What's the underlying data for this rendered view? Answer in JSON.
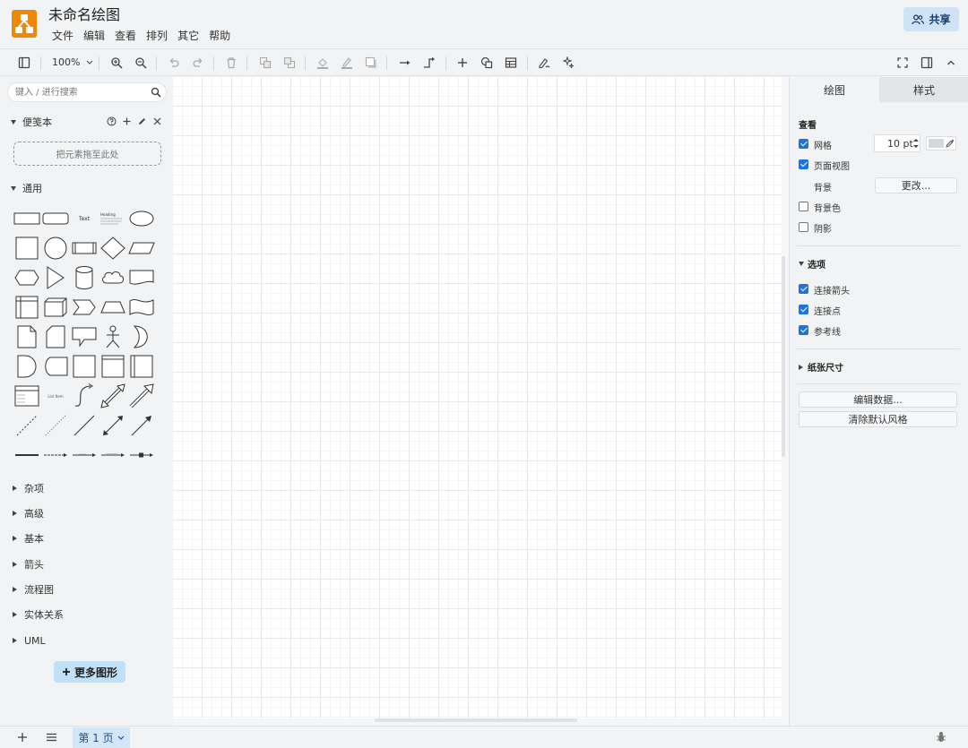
{
  "app": {
    "title": "未命名绘图",
    "accent_color": "#f08705"
  },
  "menu": [
    "文件",
    "编辑",
    "查看",
    "排列",
    "其它",
    "帮助"
  ],
  "share_button": {
    "label": "共享",
    "icon": "users-icon"
  },
  "toolbar": {
    "zoom": "100%",
    "icons": [
      "sidebar-toggle-icon",
      "zoom-in-icon",
      "zoom-out-icon",
      "undo-icon",
      "redo-icon",
      "delete-icon",
      "to-front-icon",
      "to-back-icon",
      "fill-color-icon",
      "line-color-icon",
      "shadow-icon",
      "connection-icon",
      "waypoints-icon",
      "insert-icon",
      "shapes-icon",
      "table-icon",
      "format-icon",
      "magic-icon",
      "fullscreen-icon",
      "format-panel-icon",
      "collapse-icon"
    ]
  },
  "sidebar": {
    "search_placeholder": "键入 / 进行搜索",
    "scratchpad_title": "便笺本",
    "dropzone_text": "把元素拖至此处",
    "general_title": "通用",
    "shape_text_label": "Text",
    "shape_heading_label": "Heading",
    "shape_list_label": "List Item",
    "categories": [
      "杂项",
      "高级",
      "基本",
      "箭头",
      "流程图",
      "实体关系",
      "UML"
    ],
    "more_shapes": "更多图形"
  },
  "format_panel": {
    "tabs": [
      "绘图",
      "样式"
    ],
    "view_title": "查看",
    "grid_label": "网格",
    "grid_checked": true,
    "grid_size": "10 pt",
    "page_view_label": "页面视图",
    "page_view_checked": true,
    "background_label": "背景",
    "change_button": "更改...",
    "bg_color_label": "背景色",
    "bg_color_checked": false,
    "shadow_label": "阴影",
    "shadow_checked": false,
    "options_title": "选项",
    "connect_arrows_label": "连接箭头",
    "connect_points_label": "连接点",
    "guides_label": "参考线",
    "paper_size_title": "纸张尺寸",
    "edit_data_button": "编辑数据...",
    "clear_style_button": "清除默认风格"
  },
  "bottom_bar": {
    "page_tab": "第 1 页"
  }
}
